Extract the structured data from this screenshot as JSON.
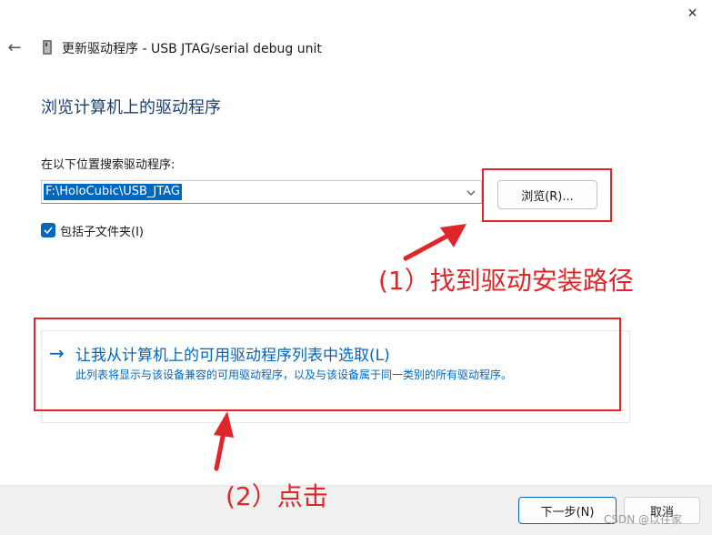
{
  "window": {
    "title": "更新驱动程序 - USB JTAG/serial debug unit",
    "close_icon": "✕",
    "back_icon": "←"
  },
  "page": {
    "heading": "浏览计算机上的驱动程序",
    "search_label": "在以下位置搜索驱动程序:",
    "path_value": "F:\\HoloCubic\\USB_JTAG",
    "browse_label": "浏览(R)...",
    "include_subfolders_label": "包括子文件夹(I)",
    "include_subfolders_checked": true
  },
  "pick_option": {
    "arrow": "→",
    "title": "让我从计算机上的可用驱动程序列表中选取(L)",
    "description": "此列表将显示与该设备兼容的可用驱动程序，以及与该设备属于同一类别的所有驱动程序。"
  },
  "footer": {
    "next_label": "下一步(N)",
    "cancel_label": "取消"
  },
  "annotations": {
    "step1": "(1）找到驱动安装路径",
    "step2": "(2）点击",
    "color": "#e0262b"
  },
  "watermark": "CSDN @以往家",
  "colors": {
    "accent": "#0067c0",
    "heading": "#1d3f74"
  }
}
